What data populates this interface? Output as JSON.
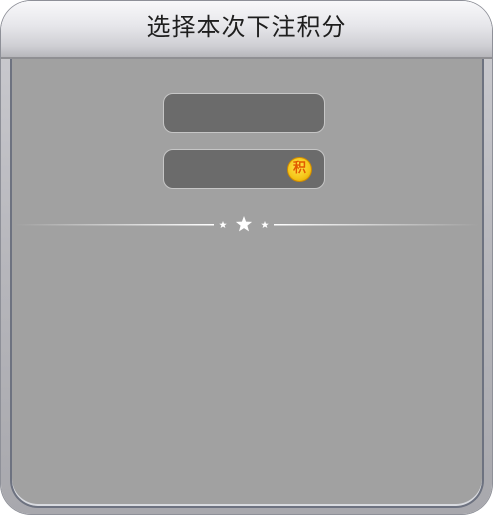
{
  "dialog": {
    "title": "选择本次下注积分"
  },
  "fields": {
    "bet_amount_value": "",
    "points_value": "",
    "points_icon_glyph": "积"
  },
  "icons": {
    "points": "coin-icon",
    "divider": "star-icon"
  },
  "colors": {
    "panel": "#a1a1a1",
    "field": "#6b6b6b",
    "coin": "#f5c518",
    "coin_text": "#e25a00"
  }
}
